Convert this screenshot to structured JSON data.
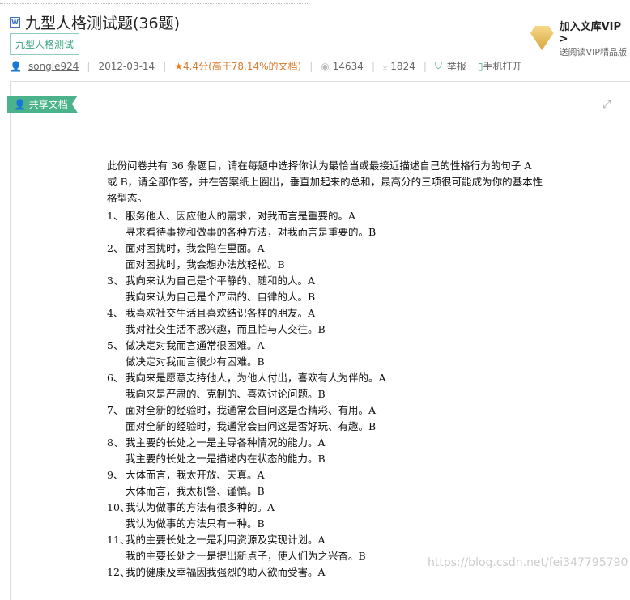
{
  "title": "九型人格测试题(36题)",
  "tag": "九型人格测试",
  "meta": {
    "user": "songle924",
    "date": "2012-03-14",
    "rating": "4.4分(高于78.14%的文档)",
    "views": "14634",
    "downloads": "1824",
    "report": "举报",
    "mobile": "手机打开"
  },
  "vip": {
    "title": "加入文库VIP >",
    "sub": "送阅读VIP精品版"
  },
  "share_label": "共享文档",
  "doc": {
    "intro": "此份问卷共有 36 条题目，请在每题中选择你认为最恰当或最接近描述自己的性格行为的句子 A 或 B，请全部作答，并在答案纸上圈出，垂直加起来的总和，最高分的三项很可能成为你的基本性格型态。",
    "items": [
      {
        "n": "1、",
        "a": "服务他人、因应他人的需求，对我而言是重要的。A",
        "b": "寻求看待事物和做事的各种方法，对我而言是重要的。B"
      },
      {
        "n": "2、",
        "a": "面对困扰时，我会陷在里面。A",
        "b": "面对困扰时，我会想办法放轻松。B"
      },
      {
        "n": "3、",
        "a": "我向来认为自己是个平静的、随和的人。A",
        "b": "我向来认为自己是个严肃的、自律的人。B"
      },
      {
        "n": "4、",
        "a": "我喜欢社交生活且喜欢结识各样的朋友。A",
        "b": "我对社交生活不感兴趣，而且怕与人交往。B"
      },
      {
        "n": "5、",
        "a": "做决定对我而言通常很困难。A",
        "b": "做决定对我而言很少有困难。B"
      },
      {
        "n": "6、",
        "a": "我向来是愿意支持他人，为他人付出，喜欢有人为伴的。A",
        "b": "我向来是严肃的、克制的、喜欢讨论问题。B"
      },
      {
        "n": "7、",
        "a": "面对全新的经验时，我通常会自问这是否精彩、有用。A",
        "b": "面对全新的经验时，我通常会自问这是否好玩、有趣。B"
      },
      {
        "n": "8、",
        "a": "我主要的长处之一是主导各种情况的能力。A",
        "b": "我主要的长处之一是描述内在状态的能力。B"
      },
      {
        "n": "9、",
        "a": "大体而言，我太开放、天真。A",
        "b": "大体而言，我太机警、谨慎。B"
      },
      {
        "n": "10、",
        "a": "我认为做事的方法有很多种的。A",
        "b": "我认为做事的方法只有一种。B"
      },
      {
        "n": "11、",
        "a": "我的主要长处之一是利用资源及实现计划。A",
        "b": "我的主要长处之一是提出新点子，使人们为之兴奋。B"
      },
      {
        "n": "12、",
        "a": "我的健康及幸福因我强烈的助人欲而受害。A"
      }
    ]
  },
  "watermark": "https://blog.csdn.net/fei347795790"
}
